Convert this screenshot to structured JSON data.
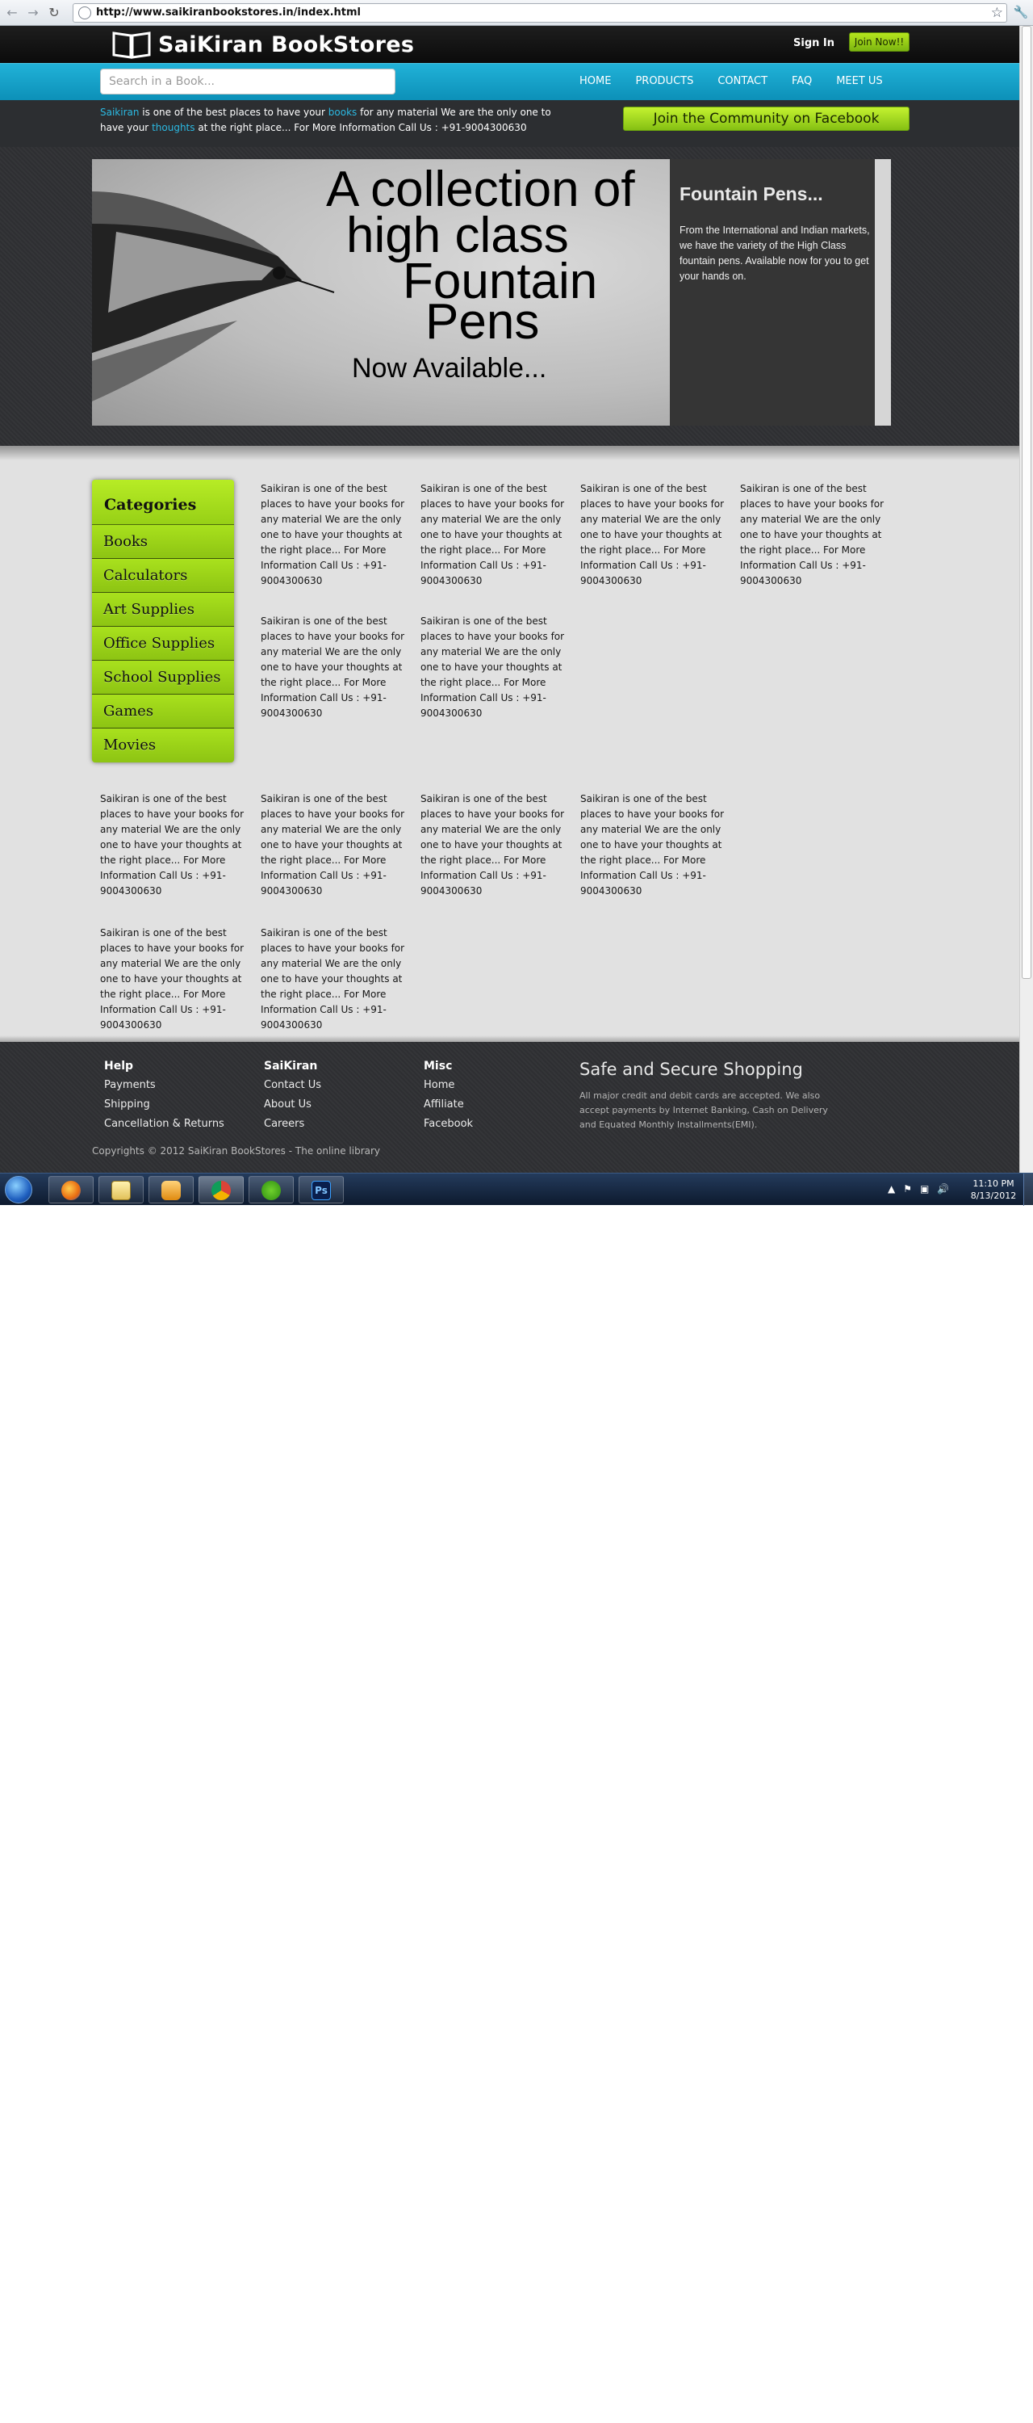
{
  "browser": {
    "url": "http://www.saikiranbookstores.in/index.html"
  },
  "header": {
    "logo_text": "SaiKiran BookStores",
    "signin_label": "Sign In",
    "join_label": "Join Now!!"
  },
  "nav": {
    "search_placeholder": "Search in a Book...",
    "items": [
      "HOME",
      "PRODUCTS",
      "CONTACT",
      "FAQ",
      "MEET US"
    ]
  },
  "info": {
    "p1": "Saikiran",
    "p2": " is one of the best places to have your ",
    "p3": "books",
    "p4": " for any material We are the only one to have your ",
    "p5": "thoughts",
    "p6": " at the right place... For More Information Call Us : +91-9004300630",
    "facebook_label": "Join the Community on Facebook",
    "highlight_color": "#2bb9e2"
  },
  "hero": {
    "line1": "A collection of",
    "line2": "high class",
    "line3": "Fountain",
    "line4": "Pens",
    "line5": "Now Available...",
    "side_title": "Fountain Pens...",
    "side_desc": "From the International and Indian markets, we have the variety of the High Class fountain pens. Available now for you to get your hands on."
  },
  "categories": {
    "title": "Categories",
    "items": [
      "Books",
      "Calculators",
      "Art Supplies",
      "Office Supplies",
      "School Supplies",
      "Games",
      "Movies"
    ]
  },
  "products": {
    "blurb": "Saikiran is one of the best places to have your books for any material We are the only one to have your thoughts at the right place... For More Information Call Us : +91-9004300630"
  },
  "footer": {
    "help": {
      "title": "Help",
      "links": [
        "Payments",
        "Shipping",
        "Cancellation & Returns"
      ]
    },
    "saikiran": {
      "title": "SaiKiran",
      "links": [
        "Contact Us",
        "About Us",
        "Careers"
      ]
    },
    "misc": {
      "title": "Misc",
      "links": [
        "Home",
        "Affiliate",
        "Facebook"
      ]
    },
    "secure_title": "Safe and Secure Shopping",
    "secure_text": "All major credit and debit cards are accepted. We also accept payments by Internet Banking, Cash on Delivery and Equated Monthly Installments(EMI).",
    "copyright": "Copyrights © 2012 SaiKiran BookStores - The online library"
  },
  "taskbar": {
    "apps": [
      "firefox-icon",
      "explorer-icon",
      "media-player-icon",
      "chrome-icon",
      "utorrent-icon",
      "photoshop-icon"
    ],
    "photoshop_label": "Ps",
    "time": "11:10 PM",
    "date": "8/13/2012"
  },
  "colors": {
    "accent_green": "#9bd219",
    "nav_blue": "#21b2d8",
    "dark_band": "#2f3033"
  }
}
